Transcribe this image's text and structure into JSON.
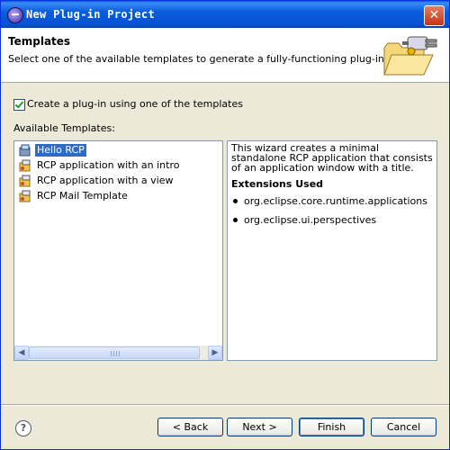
{
  "window": {
    "title": "New Plug-in Project",
    "close_icon": "close-icon"
  },
  "banner": {
    "title": "Templates",
    "description": "Select one of the available templates to generate a fully-functioning plug-in."
  },
  "checkbox": {
    "label": "Create a plug-in using one of the templates",
    "checked": true
  },
  "available_label": "Available Templates:",
  "templates": [
    {
      "label": "Hello RCP",
      "selected": true
    },
    {
      "label": "RCP application with an intro",
      "selected": false
    },
    {
      "label": "RCP application with a view",
      "selected": false
    },
    {
      "label": "RCP Mail Template",
      "selected": false
    }
  ],
  "description": {
    "text": "This wizard creates a minimal standalone RCP application that consists of an application window with a title.",
    "extensions_heading": "Extensions Used",
    "extensions": [
      "org.eclipse.core.runtime.applications",
      "org.eclipse.ui.perspectives"
    ]
  },
  "buttons": {
    "help": "?",
    "back": "< Back",
    "next": "Next >",
    "finish": "Finish",
    "cancel": "Cancel"
  }
}
